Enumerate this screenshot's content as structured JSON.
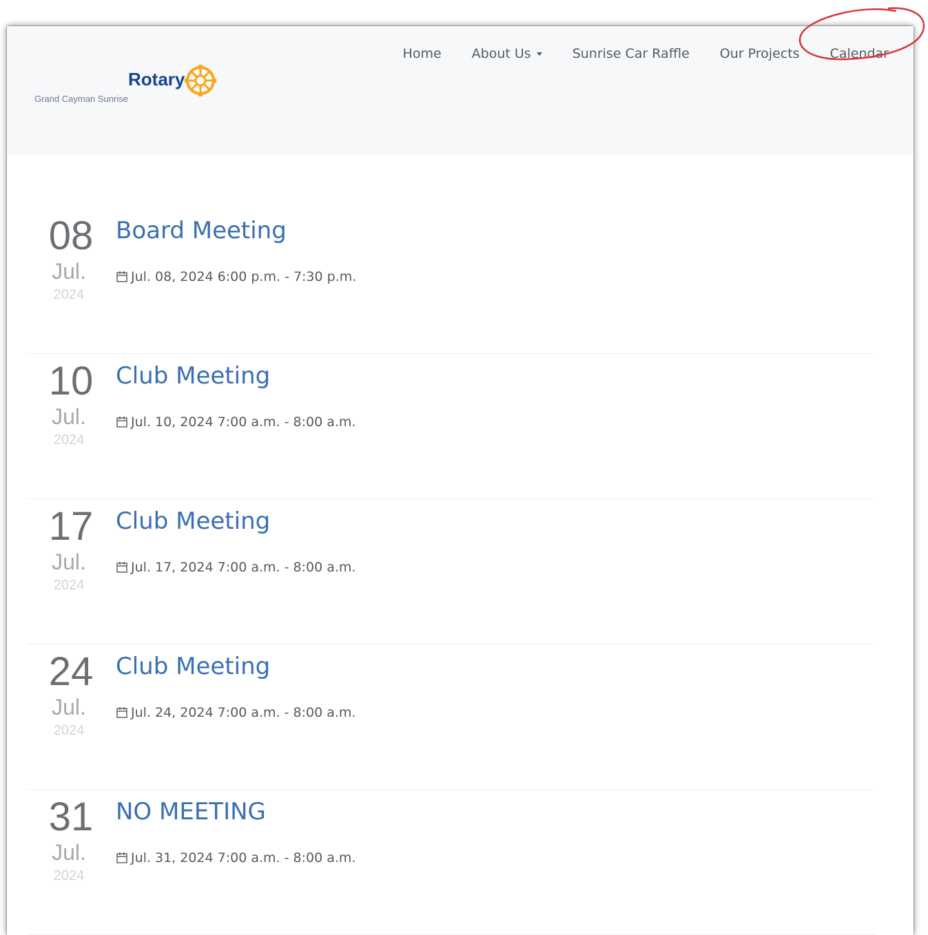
{
  "site": {
    "logo_word": "Rotary",
    "logo_sub": "Grand Cayman Sunrise",
    "logo_icon": "rotary-wheel-icon",
    "brand_blue": "#17458f",
    "brand_gold": "#f7a81b"
  },
  "nav": {
    "home": "Home",
    "about": "About Us",
    "raffle": "Sunrise Car Raffle",
    "projects": "Our Projects",
    "calendar": "Calendar",
    "highlight_color": "#d9343b"
  },
  "events": [
    {
      "day": "08",
      "month": "Jul.",
      "year": "2024",
      "title": "Board Meeting",
      "when": "Jul. 08, 2024 6:00 p.m. - 7:30 p.m."
    },
    {
      "day": "10",
      "month": "Jul.",
      "year": "2024",
      "title": "Club Meeting",
      "when": "Jul. 10, 2024 7:00 a.m. - 8:00 a.m."
    },
    {
      "day": "17",
      "month": "Jul.",
      "year": "2024",
      "title": "Club Meeting",
      "when": "Jul. 17, 2024 7:00 a.m. - 8:00 a.m."
    },
    {
      "day": "24",
      "month": "Jul.",
      "year": "2024",
      "title": "Club Meeting",
      "when": "Jul. 24, 2024 7:00 a.m. - 8:00 a.m."
    },
    {
      "day": "31",
      "month": "Jul.",
      "year": "2024",
      "title": "NO MEETING",
      "when": "Jul. 31, 2024 7:00 a.m. - 8:00 a.m."
    }
  ]
}
